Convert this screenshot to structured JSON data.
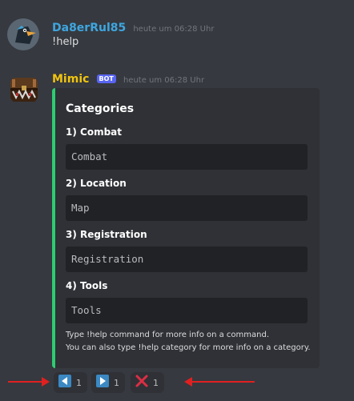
{
  "messages": [
    {
      "username": "Da8erRul85",
      "timestamp": "heute um 06:28 Uhr",
      "text": "!help",
      "username_color": "#3ea6e0"
    },
    {
      "username": "Mimic",
      "badge": "BOT",
      "timestamp": "heute um 06:28 Uhr",
      "username_color": "#f1c40f"
    }
  ],
  "embed": {
    "title": "Categories",
    "accent_color": "#2ecc71",
    "fields": [
      {
        "name": "1) Combat",
        "value": "Combat"
      },
      {
        "name": "2) Location",
        "value": "Map"
      },
      {
        "name": "3) Registration",
        "value": "Registration"
      },
      {
        "name": "4) Tools",
        "value": "Tools"
      }
    ],
    "footer_lines": [
      "Type !help command for more info on a command.",
      "You can also type !help category for more info on a category."
    ]
  },
  "reactions": [
    {
      "icon": "arrow-left-icon",
      "count": "1"
    },
    {
      "icon": "arrow-right-icon",
      "count": "1"
    },
    {
      "icon": "x-icon",
      "count": "1"
    }
  ],
  "annotations": {
    "arrow_color": "#e02020"
  }
}
